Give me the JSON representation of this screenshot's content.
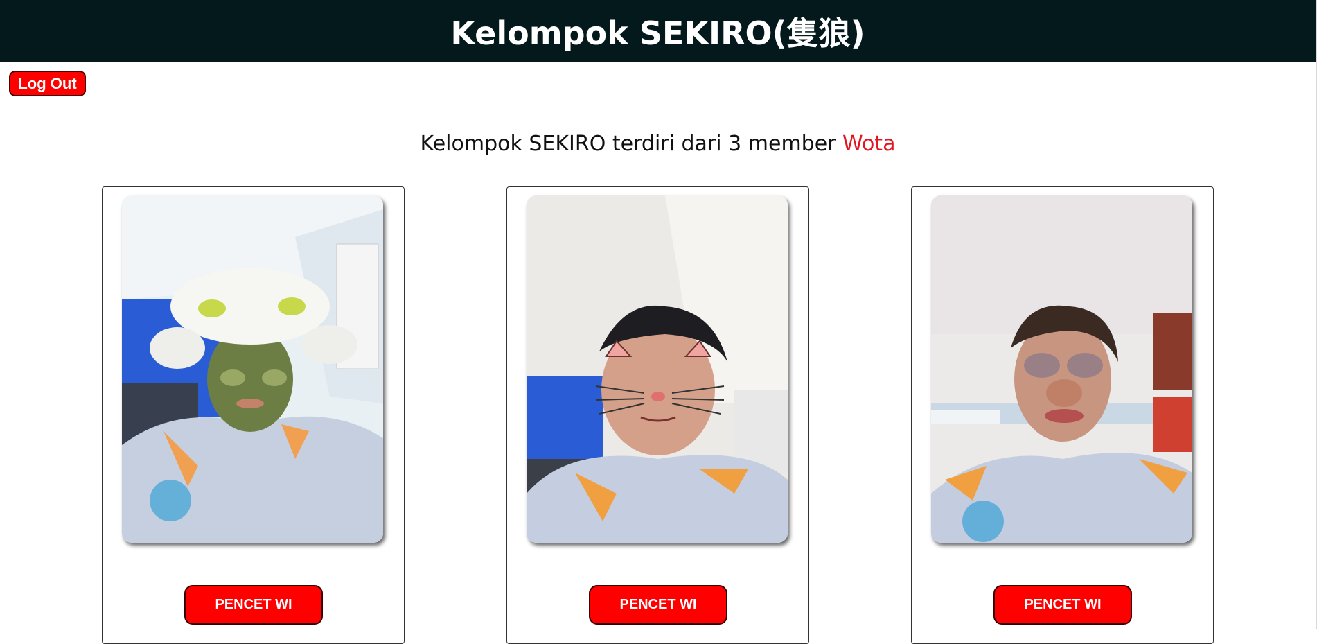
{
  "header": {
    "title": "Kelompok SEKIRO(隻狼)",
    "background": "#03191b"
  },
  "logout_button": {
    "label": "Log Out"
  },
  "intro": {
    "text": "Kelompok SEKIRO terdiri dari 3 member ",
    "accent_text": "Wota",
    "accent_color": "#e3141d"
  },
  "members": [
    {
      "photo": "member photo with green face mask filter",
      "button_label": "PENCET WI"
    },
    {
      "photo": "member photo with cat whiskers filter",
      "button_label": "PENCET WI"
    },
    {
      "photo": "member photo with face paint filter",
      "button_label": "PENCET WI"
    }
  ],
  "colors": {
    "button_red": "#ff0000",
    "text_dark": "#111111"
  }
}
